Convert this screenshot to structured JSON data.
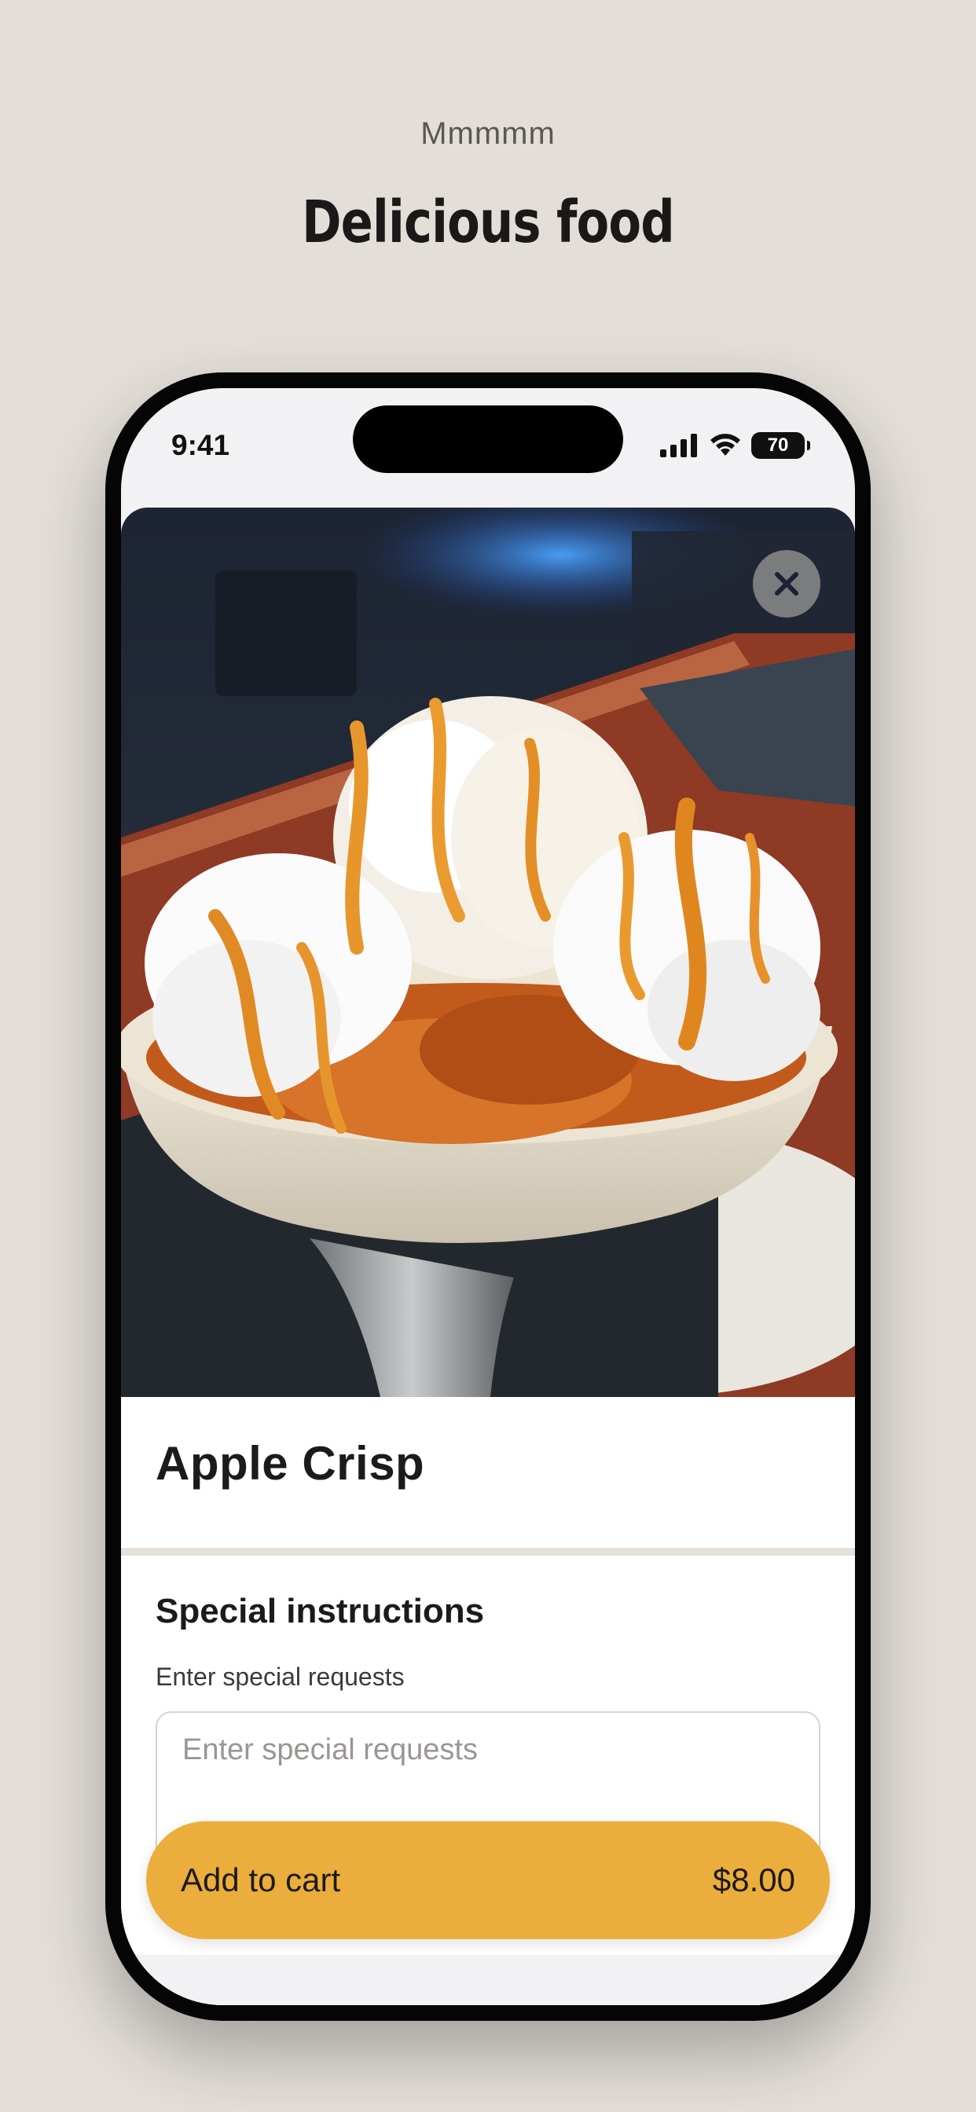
{
  "header": {
    "tagline": "Mmmmm",
    "headline": "Delicious food"
  },
  "status_bar": {
    "time": "9:41",
    "battery": "70"
  },
  "item": {
    "name": "Apple Crisp",
    "image_icon": "apple-crisp-dessert-photo"
  },
  "special_instructions": {
    "title": "Special instructions",
    "subtitle": "Enter special requests",
    "placeholder": "Enter special requests",
    "value": ""
  },
  "cart": {
    "label": "Add to cart",
    "price": "$8.00"
  },
  "colors": {
    "background": "#e3ded8",
    "accent": "#ebae3c",
    "text": "#1d1b1a"
  }
}
